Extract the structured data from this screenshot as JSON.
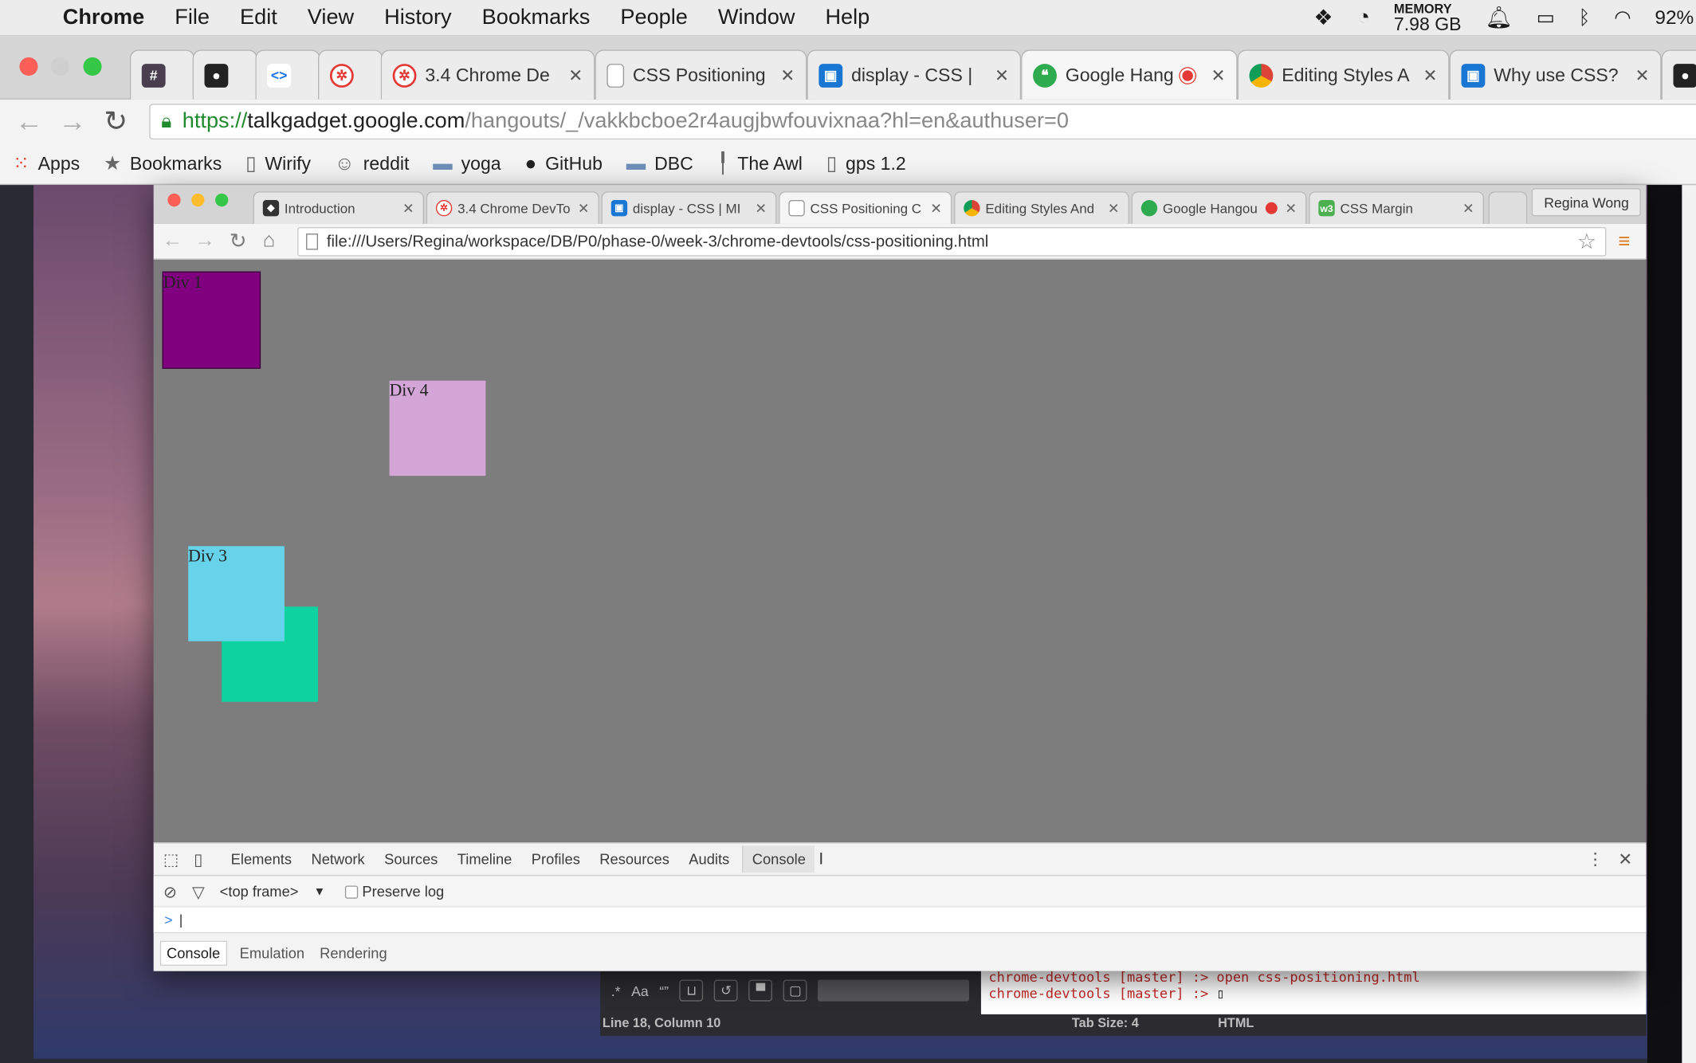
{
  "menubar": {
    "apple_icon": "apple-logo",
    "app_name": "Chrome",
    "items": [
      "File",
      "Edit",
      "View",
      "History",
      "Bookmarks",
      "People",
      "Window",
      "Help"
    ],
    "memory_label": "MEMORY",
    "memory_value": "7.98 GB",
    "battery": "92%"
  },
  "outer_tabs": [
    {
      "label": "",
      "icon": "hash-icon",
      "color": "#4a3f4f"
    },
    {
      "label": "",
      "icon": "github-icon",
      "color": "#222222"
    },
    {
      "label": "",
      "icon": "code-icon",
      "color": "#1a73e8"
    },
    {
      "label": "",
      "icon": "devbootcamp-icon",
      "color": "#e53935"
    },
    {
      "label": "3.4 Chrome De",
      "icon": "devbootcamp-icon",
      "color": "#e53935"
    },
    {
      "label": "CSS Positioning",
      "icon": "document-icon",
      "color": "#ffffff"
    },
    {
      "label": "display - CSS |",
      "icon": "mdn-icon",
      "color": "#1976d2"
    },
    {
      "label": "Google Hang",
      "icon": "hangouts-icon",
      "color": "#2eaa4f"
    },
    {
      "label": "Editing Styles A",
      "icon": "chrome-icon",
      "color": "#db4437"
    },
    {
      "label": "Why use CSS?",
      "icon": "mdn-icon",
      "color": "#1976d2"
    }
  ],
  "outer_url": {
    "scheme": "https://",
    "domain": "talkgadget.google.com",
    "path": "/hangouts/_/vakkbcboe2r4augjbwfouvixnaa?hl=en&authuser=0"
  },
  "bookmarks": [
    "Apps",
    "Bookmarks",
    "Wirify",
    "reddit",
    "yoga",
    "GitHub",
    "DBC",
    "The Awl",
    "gps 1.2"
  ],
  "bookmark_icons": [
    "apps-grid-icon",
    "star-icon",
    "document-icon",
    "reddit-icon",
    "folder-icon",
    "github-icon",
    "folder-icon",
    "pin-icon",
    "document-icon"
  ],
  "editor": {
    "terminal_line1": "chrome-devtools [master] :> open css-positioning.html",
    "terminal_line2": "chrome-devtools [master] :> ",
    "status_position": "Line 18, Column 10",
    "status_tab": "Tab Size: 4",
    "status_lang": "HTML"
  },
  "inner_tabs": [
    {
      "label": "Introduction",
      "icon": "dbc-icon",
      "color": "#333333"
    },
    {
      "label": "3.4 Chrome DevTo",
      "icon": "devbootcamp-icon",
      "color": "#e53935"
    },
    {
      "label": "display - CSS | MI",
      "icon": "mdn-icon",
      "color": "#1976d2"
    },
    {
      "label": "CSS Positioning C",
      "icon": "document-icon",
      "color": "#ffffff"
    },
    {
      "label": "Editing Styles And",
      "icon": "chrome-icon",
      "color": "#db4437"
    },
    {
      "label": "Google Hangou",
      "icon": "hangouts-icon",
      "color": "#2eaa4f"
    },
    {
      "label": "CSS Margin",
      "icon": "w3-icon",
      "color": "#4caf50"
    }
  ],
  "inner_user": "Regina Wong",
  "inner_url": "file:///Users/Regina/workspace/DB/P0/phase-0/week-3/chrome-devtools/css-positioning.html",
  "page": {
    "div1": {
      "label": "Div 1",
      "color": "#800080"
    },
    "div4": {
      "label": "Div 4",
      "color": "#d4a6d8"
    },
    "div3": {
      "label": "Div 3",
      "color": "#66d3ea"
    },
    "div2": {
      "color": "#0ed3a0"
    }
  },
  "devtools": {
    "tabs": [
      "Elements",
      "Network",
      "Sources",
      "Timeline",
      "Profiles",
      "Resources",
      "Audits",
      "Console"
    ],
    "active_tab": "Console",
    "frame_select": "<top frame>",
    "preserve_log": "Preserve log",
    "prompt": ">",
    "drawer_tabs": [
      "Console",
      "Emulation",
      "Rendering"
    ]
  }
}
